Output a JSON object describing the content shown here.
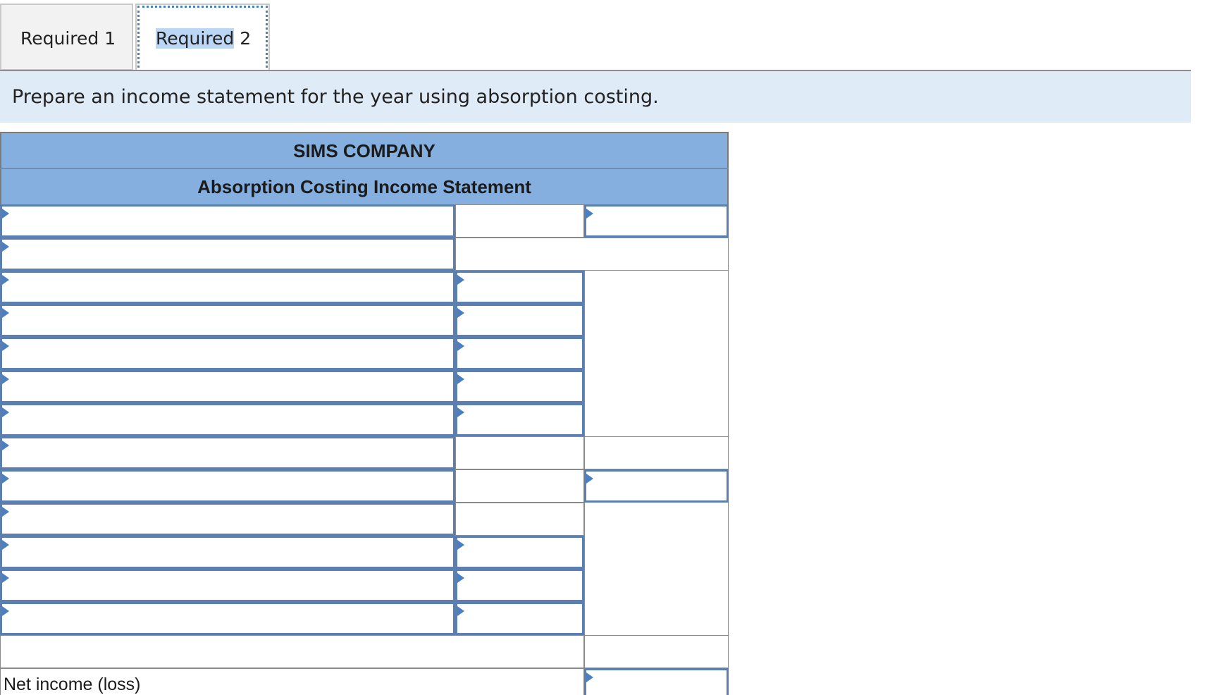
{
  "tabs": [
    {
      "label": "Required 1",
      "active": false
    },
    {
      "label_selected": "Required",
      "label_rest": " 2",
      "active": true
    }
  ],
  "instruction": "Prepare an income statement for the year using absorption costing.",
  "statement": {
    "company": "SIMS COMPANY",
    "title": "Absorption Costing Income Statement",
    "net_income_label": "Net income (loss)"
  },
  "colors": {
    "header_fill": "#84afdf",
    "banner_fill": "#dfebf7",
    "input_border": "#5a7fb0",
    "dropdown_arrow": "#4a7fc1",
    "selection_highlight": "#bcd7f5"
  }
}
